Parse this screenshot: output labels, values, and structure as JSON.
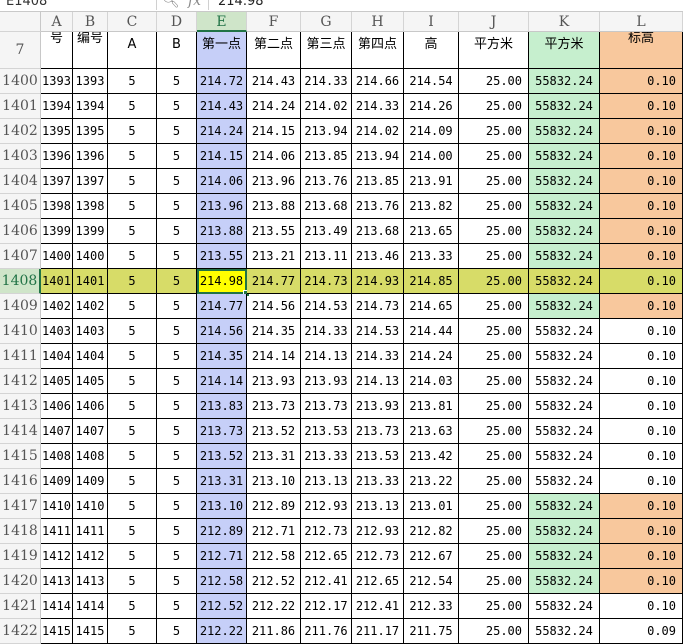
{
  "formula_bar": {
    "name_box": "E1408",
    "zoom_icon": "magnifier-icon",
    "fx_label": "fx",
    "value": "214.98"
  },
  "columns": [
    "A",
    "B",
    "C",
    "D",
    "E",
    "F",
    "G",
    "H",
    "I",
    "J",
    "K",
    "L"
  ],
  "header_row": {
    "row_number": "7",
    "cells": [
      "号",
      "编号",
      "A",
      "B",
      "第一点",
      "第二点",
      "第三点",
      "第四点",
      "高",
      "平方米",
      "平方米",
      "标高"
    ]
  },
  "rows": [
    {
      "n": "1400",
      "v": [
        "1393",
        "1393",
        "5",
        "5",
        "214.72",
        "214.43",
        "214.33",
        "214.66",
        "214.54",
        "25.00",
        "55832.24",
        "0.10"
      ],
      "flag": true
    },
    {
      "n": "1401",
      "v": [
        "1394",
        "1394",
        "5",
        "5",
        "214.43",
        "214.24",
        "214.02",
        "214.33",
        "214.26",
        "25.00",
        "55832.24",
        "0.10"
      ],
      "flag": true
    },
    {
      "n": "1402",
      "v": [
        "1395",
        "1395",
        "5",
        "5",
        "214.24",
        "214.15",
        "213.94",
        "214.02",
        "214.09",
        "25.00",
        "55832.24",
        "0.10"
      ],
      "flag": true
    },
    {
      "n": "1403",
      "v": [
        "1396",
        "1396",
        "5",
        "5",
        "214.15",
        "214.06",
        "213.85",
        "213.94",
        "214.00",
        "25.00",
        "55832.24",
        "0.10"
      ],
      "flag": true
    },
    {
      "n": "1404",
      "v": [
        "1397",
        "1397",
        "5",
        "5",
        "214.06",
        "213.96",
        "213.76",
        "213.85",
        "213.91",
        "25.00",
        "55832.24",
        "0.10"
      ],
      "flag": true
    },
    {
      "n": "1405",
      "v": [
        "1398",
        "1398",
        "5",
        "5",
        "213.96",
        "213.88",
        "213.68",
        "213.76",
        "213.82",
        "25.00",
        "55832.24",
        "0.10"
      ],
      "flag": true
    },
    {
      "n": "1406",
      "v": [
        "1399",
        "1399",
        "5",
        "5",
        "213.88",
        "213.55",
        "213.49",
        "213.68",
        "213.65",
        "25.00",
        "55832.24",
        "0.10"
      ],
      "flag": true
    },
    {
      "n": "1407",
      "v": [
        "1400",
        "1400",
        "5",
        "5",
        "213.55",
        "213.21",
        "213.11",
        "213.46",
        "213.33",
        "25.00",
        "55832.24",
        "0.10"
      ],
      "flag": true
    },
    {
      "n": "1408",
      "v": [
        "1401",
        "1401",
        "5",
        "5",
        "214.98",
        "214.77",
        "214.73",
        "214.93",
        "214.85",
        "25.00",
        "55832.24",
        "0.10"
      ],
      "flag": true,
      "selected": true
    },
    {
      "n": "1409",
      "v": [
        "1402",
        "1402",
        "5",
        "5",
        "214.77",
        "214.56",
        "214.53",
        "214.73",
        "214.65",
        "25.00",
        "55832.24",
        "0.10"
      ],
      "flag": true
    },
    {
      "n": "1410",
      "v": [
        "1403",
        "1403",
        "5",
        "5",
        "214.56",
        "214.35",
        "214.33",
        "214.53",
        "214.44",
        "25.00",
        "55832.24",
        "0.10"
      ],
      "flag": false
    },
    {
      "n": "1411",
      "v": [
        "1404",
        "1404",
        "5",
        "5",
        "214.35",
        "214.14",
        "214.13",
        "214.33",
        "214.24",
        "25.00",
        "55832.24",
        "0.10"
      ],
      "flag": false
    },
    {
      "n": "1412",
      "v": [
        "1405",
        "1405",
        "5",
        "5",
        "214.14",
        "213.93",
        "213.93",
        "214.13",
        "214.03",
        "25.00",
        "55832.24",
        "0.10"
      ],
      "flag": false
    },
    {
      "n": "1413",
      "v": [
        "1406",
        "1406",
        "5",
        "5",
        "213.83",
        "213.73",
        "213.73",
        "213.93",
        "213.81",
        "25.00",
        "55832.24",
        "0.10"
      ],
      "flag": false
    },
    {
      "n": "1414",
      "v": [
        "1407",
        "1407",
        "5",
        "5",
        "213.73",
        "213.52",
        "213.53",
        "213.73",
        "213.63",
        "25.00",
        "55832.24",
        "0.10"
      ],
      "flag": false
    },
    {
      "n": "1415",
      "v": [
        "1408",
        "1408",
        "5",
        "5",
        "213.52",
        "213.31",
        "213.33",
        "213.53",
        "213.42",
        "25.00",
        "55832.24",
        "0.10"
      ],
      "flag": false
    },
    {
      "n": "1416",
      "v": [
        "1409",
        "1409",
        "5",
        "5",
        "213.31",
        "213.10",
        "213.13",
        "213.33",
        "213.22",
        "25.00",
        "55832.24",
        "0.10"
      ],
      "flag": false
    },
    {
      "n": "1417",
      "v": [
        "1410",
        "1410",
        "5",
        "5",
        "213.10",
        "212.89",
        "212.93",
        "213.13",
        "213.01",
        "25.00",
        "55832.24",
        "0.10"
      ],
      "flag": true
    },
    {
      "n": "1418",
      "v": [
        "1411",
        "1411",
        "5",
        "5",
        "212.89",
        "212.71",
        "212.73",
        "212.93",
        "212.82",
        "25.00",
        "55832.24",
        "0.10"
      ],
      "flag": true
    },
    {
      "n": "1419",
      "v": [
        "1412",
        "1412",
        "5",
        "5",
        "212.71",
        "212.58",
        "212.65",
        "212.73",
        "212.67",
        "25.00",
        "55832.24",
        "0.10"
      ],
      "flag": true
    },
    {
      "n": "1420",
      "v": [
        "1413",
        "1413",
        "5",
        "5",
        "212.58",
        "212.52",
        "212.41",
        "212.65",
        "212.54",
        "25.00",
        "55832.24",
        "0.10"
      ],
      "flag": true
    },
    {
      "n": "1421",
      "v": [
        "1414",
        "1414",
        "5",
        "5",
        "212.52",
        "212.22",
        "212.17",
        "212.41",
        "212.33",
        "25.00",
        "55832.24",
        "0.10"
      ],
      "flag": false
    },
    {
      "n": "1422",
      "v": [
        "1415",
        "1415",
        "5",
        "5",
        "212.22",
        "211.86",
        "211.76",
        "211.17",
        "211.75",
        "25.00",
        "55832.24",
        "0.09"
      ],
      "flag": false
    }
  ],
  "colors": {
    "blue_col": "#c6cff8",
    "green_fill": "#c6efce",
    "orange_fill": "#f8c89d",
    "selected_row": "#d7dc68",
    "active_cell": "#ffff00",
    "accent": "#217346"
  }
}
